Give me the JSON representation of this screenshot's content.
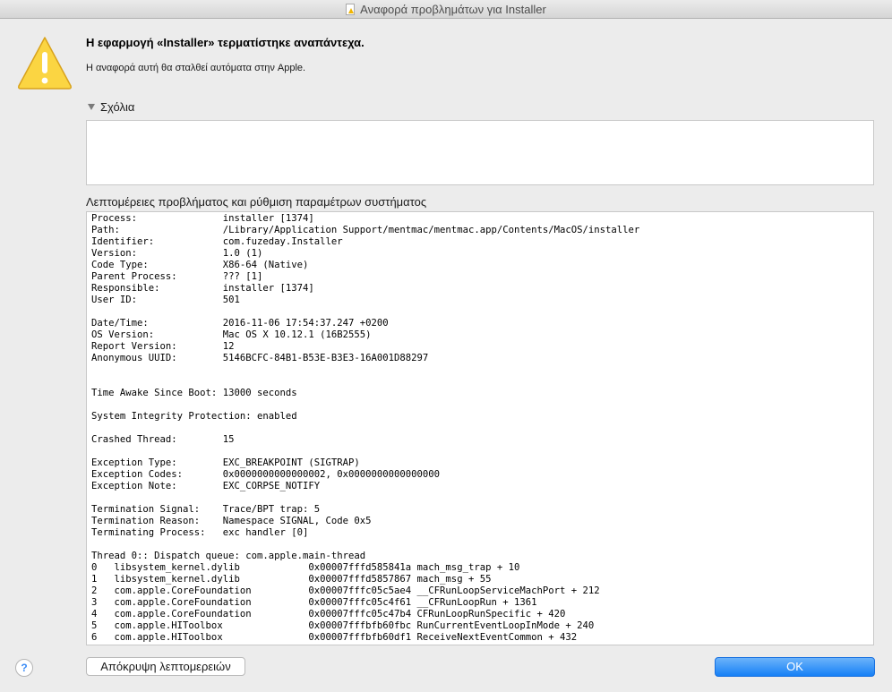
{
  "window": {
    "title": "Αναφορά προβλημάτων για Installer"
  },
  "icons": {
    "title_doc": "document-icon",
    "warning": "warning-triangle-icon",
    "help": "help-icon",
    "disclosure": "disclosure-triangle-icon"
  },
  "dialog": {
    "heading": "Η εφαρμογή «Installer» τερματίστηκε αναπάντεχα.",
    "subtext": "Η αναφορά αυτή θα σταλθεί αυτόματα στην Apple.",
    "comments_label": "Σχόλια",
    "comments_value": "",
    "details_label": "Λεπτομέρειες προβλήματος και ρύθμιση παραμέτρων συστήματος",
    "report_lines": [
      "Process:               installer [1374]",
      "Path:                  /Library/Application Support/mentmac/mentmac.app/Contents/MacOS/installer",
      "Identifier:            com.fuzeday.Installer",
      "Version:               1.0 (1)",
      "Code Type:             X86-64 (Native)",
      "Parent Process:        ??? [1]",
      "Responsible:           installer [1374]",
      "User ID:               501",
      "",
      "Date/Time:             2016-11-06 17:54:37.247 +0200",
      "OS Version:            Mac OS X 10.12.1 (16B2555)",
      "Report Version:        12",
      "Anonymous UUID:        5146BCFC-84B1-B53E-B3E3-16A001D88297",
      "",
      "",
      "Time Awake Since Boot: 13000 seconds",
      "",
      "System Integrity Protection: enabled",
      "",
      "Crashed Thread:        15",
      "",
      "Exception Type:        EXC_BREAKPOINT (SIGTRAP)",
      "Exception Codes:       0x0000000000000002, 0x0000000000000000",
      "Exception Note:        EXC_CORPSE_NOTIFY",
      "",
      "Termination Signal:    Trace/BPT trap: 5",
      "Termination Reason:    Namespace SIGNAL, Code 0x5",
      "Terminating Process:   exc handler [0]",
      "",
      "Thread 0:: Dispatch queue: com.apple.main-thread",
      "0   libsystem_kernel.dylib            0x00007fffd585841a mach_msg_trap + 10",
      "1   libsystem_kernel.dylib            0x00007fffd5857867 mach_msg + 55",
      "2   com.apple.CoreFoundation          0x00007fffc05c5ae4 __CFRunLoopServiceMachPort + 212",
      "3   com.apple.CoreFoundation          0x00007fffc05c4f61 __CFRunLoopRun + 1361",
      "4   com.apple.CoreFoundation          0x00007fffc05c47b4 CFRunLoopRunSpecific + 420",
      "5   com.apple.HIToolbox               0x00007fffbfb60fbc RunCurrentEventLoopInMode + 240",
      "6   com.apple.HIToolbox               0x00007fffbfb60df1 ReceiveNextEventCommon + 432"
    ]
  },
  "buttons": {
    "help": "?",
    "hide_details": "Απόκρυψη λεπτομερειών",
    "ok": "OK"
  },
  "colors": {
    "ok_button": "#1680f6",
    "warning_fill": "#fbd542",
    "window_bg": "#ececec"
  }
}
